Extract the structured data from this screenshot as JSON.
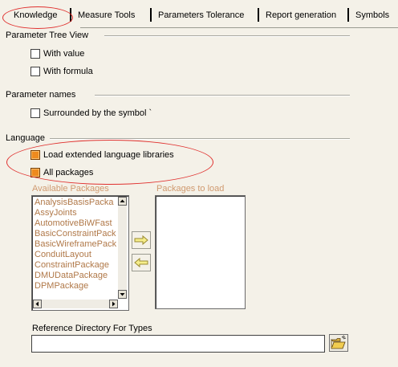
{
  "tabs": [
    {
      "label": "Knowledge",
      "active": true
    },
    {
      "label": "Measure Tools"
    },
    {
      "label": "Parameters Tolerance"
    },
    {
      "label": "Report generation"
    },
    {
      "label": "Symbols"
    }
  ],
  "groups": {
    "parameter_tree_view": {
      "title": "Parameter Tree View",
      "options": [
        {
          "label": "With value",
          "checked": false
        },
        {
          "label": "With formula",
          "checked": false
        }
      ]
    },
    "parameter_names": {
      "title": "Parameter names",
      "options": [
        {
          "label": "Surrounded by the symbol `",
          "checked": false
        }
      ]
    },
    "language": {
      "title": "Language",
      "options": [
        {
          "label": "Load extended language libraries",
          "checked": true
        },
        {
          "label": "All packages",
          "checked": true
        }
      ],
      "available_packages": {
        "caption": "Available Packages",
        "items": [
          "AnalysisBasisPacka",
          "AssyJoints",
          "AutomotiveBiWFast",
          "BasicConstraintPack",
          "BasicWireframePack",
          "ConduitLayout",
          "ConstraintPackage",
          "DMUDataPackage",
          "DPMPackage"
        ]
      },
      "packages_to_load": {
        "caption": "Packages to load",
        "items": []
      }
    },
    "reference_directory": {
      "label": "Reference Directory For Types",
      "value": ""
    }
  },
  "colors": {
    "highlight_ellipse": "#e0302e",
    "checkbox_on": "#ee8a1e",
    "disabled_text": "#b07848"
  }
}
